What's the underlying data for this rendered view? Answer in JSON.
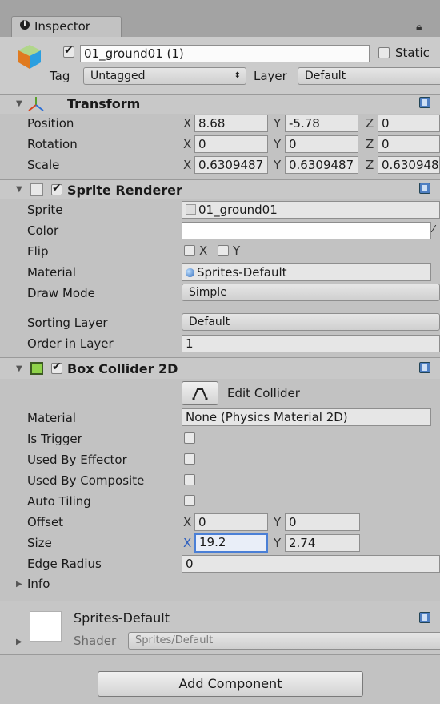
{
  "window": {
    "tab_label": "Inspector"
  },
  "gameobject": {
    "active": true,
    "name": "01_ground01 (1)",
    "static_label": "Static",
    "tag_label": "Tag",
    "tag_value": "Untagged",
    "layer_label": "Layer",
    "layer_value": "Default"
  },
  "transform": {
    "title": "Transform",
    "position": {
      "label": "Position",
      "x": "8.68",
      "y": "-5.78",
      "z": "0"
    },
    "rotation": {
      "label": "Rotation",
      "x": "0",
      "y": "0",
      "z": "0"
    },
    "scale": {
      "label": "Scale",
      "x": "0.6309487",
      "y": "0.6309487",
      "z": "0.630948"
    }
  },
  "sprite_renderer": {
    "enabled": true,
    "title": "Sprite Renderer",
    "sprite_label": "Sprite",
    "sprite_value": "01_ground01",
    "color_label": "Color",
    "color_value": "#ffffff",
    "flip_label": "Flip",
    "flip_x": "X",
    "flip_y": "Y",
    "material_label": "Material",
    "material_value": "Sprites-Default",
    "draw_mode_label": "Draw Mode",
    "draw_mode_value": "Simple",
    "sorting_layer_label": "Sorting Layer",
    "sorting_layer_value": "Default",
    "order_label": "Order in Layer",
    "order_value": "1"
  },
  "box_collider": {
    "enabled": true,
    "title": "Box Collider 2D",
    "edit_collider_label": "Edit Collider",
    "material_label": "Material",
    "material_value": "None (Physics Material 2D)",
    "is_trigger_label": "Is Trigger",
    "used_by_effector_label": "Used By Effector",
    "used_by_composite_label": "Used By Composite",
    "auto_tiling_label": "Auto Tiling",
    "offset_label": "Offset",
    "offset_x": "0",
    "offset_y": "0",
    "size_label": "Size",
    "size_x": "19.2",
    "size_y": "2.74",
    "edge_radius_label": "Edge Radius",
    "edge_radius_value": "0",
    "info_label": "Info"
  },
  "material_preview": {
    "name": "Sprites-Default",
    "shader_label": "Shader",
    "shader_value": "Sprites/Default"
  },
  "add_component_label": "Add Component",
  "axes": {
    "x": "X",
    "y": "Y",
    "z": "Z"
  },
  "colors": {
    "accent": "#4a7fd6",
    "panel": "#c2c2c2",
    "header": "#c8c8c8"
  }
}
